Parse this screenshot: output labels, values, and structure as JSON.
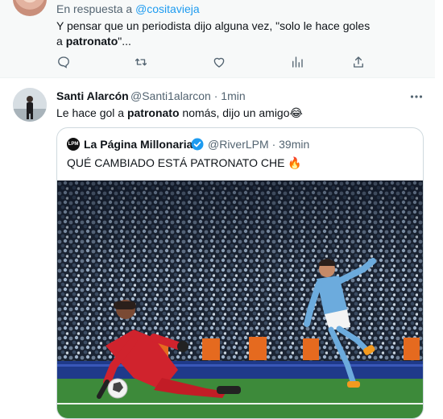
{
  "reply_tweet": {
    "in_reply_prefix": "En respuesta a",
    "in_reply_handle": "@cositavieja",
    "text_before": "Y pensar que un periodista dijo alguna vez, \"solo le hace goles a ",
    "text_bold": "patronato",
    "text_after": "\"..."
  },
  "actions": [
    "reply-icon",
    "retweet-icon",
    "like-icon",
    "views-icon",
    "share-icon"
  ],
  "tweet": {
    "author_name": "Santi Alarcón",
    "handle": "@Santi1alarcon",
    "time": "1min",
    "separator": "·",
    "text_before": "Le hace gol a ",
    "text_bold": "patronato",
    "text_after": " nomás, dijo un amigo😂"
  },
  "quoted_tweet": {
    "logo_text": "LPM",
    "author_name": "La Página Millonaria",
    "handle": "@RiverLPM",
    "time": "39min",
    "separator": "·",
    "text": "QUÉ CAMBIADO ESTÁ PATRONATO CHE 🔥"
  },
  "colors": {
    "link": "#1d9bf0",
    "muted": "#536471",
    "verified": "#1d9bf0",
    "city_blue": "#6cabdd",
    "keeper_red": "#d0232d"
  }
}
